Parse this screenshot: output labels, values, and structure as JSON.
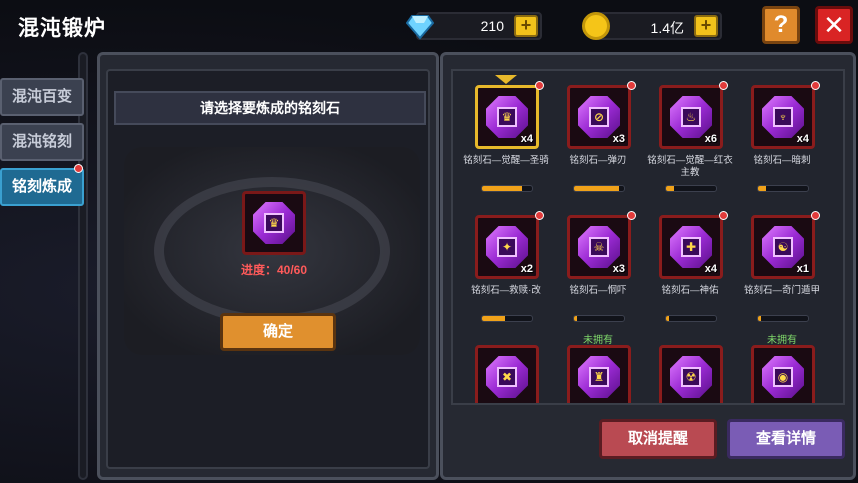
{
  "title": "混沌锻炉",
  "currency": {
    "gems": "210",
    "gold": "1.4亿",
    "plus": "+"
  },
  "buttons": {
    "help": "?",
    "close": "✕",
    "confirm": "确定",
    "cancel_reminder": "取消提醒",
    "view_details": "查看详情"
  },
  "tabs": [
    "混沌百变",
    "混沌铭刻",
    "铭刻炼成"
  ],
  "left": {
    "prompt": "请选择要炼成的铭刻石",
    "progress": "进度：40/60",
    "main_gem_symbol": "♛"
  },
  "cards": [
    {
      "name": "铭刻石—觉醒—圣骑",
      "qty": "x4",
      "progress": 0.8,
      "symbol": "♛",
      "selected": true
    },
    {
      "name": "铭刻石—弹刃",
      "qty": "x3",
      "progress": 0.9,
      "symbol": "⊘"
    },
    {
      "name": "铭刻石—觉醒—红衣主教",
      "qty": "x6",
      "progress": 0.15,
      "symbol": "♨"
    },
    {
      "name": "铭刻石—暗刺",
      "qty": "x4",
      "progress": 0.15,
      "symbol": "♆"
    },
    {
      "name": "铭刻石—救赎·改",
      "qty": "x2",
      "progress": 0.45,
      "symbol": "✦"
    },
    {
      "name": "铭刻石—恫吓",
      "qty": "x3",
      "progress": 0.05,
      "symbol": "☠"
    },
    {
      "name": "铭刻石—神佑",
      "qty": "x4",
      "progress": 0.05,
      "symbol": "✚"
    },
    {
      "name": "铭刻石—奇门遁甲",
      "qty": "x1",
      "progress": 0.05,
      "symbol": "☯"
    },
    {
      "name": "",
      "qty": "",
      "progress": null,
      "symbol": "✖",
      "unowned": ""
    },
    {
      "name": "",
      "qty": "",
      "progress": null,
      "symbol": "♜",
      "unowned": "未拥有"
    },
    {
      "name": "",
      "qty": "",
      "progress": null,
      "symbol": "☢",
      "unowned": ""
    },
    {
      "name": "",
      "qty": "",
      "progress": null,
      "symbol": "◉",
      "unowned": "未拥有"
    }
  ],
  "colors": {
    "accent_blue": "#1f6a92",
    "confirm_orange": "#e0902e",
    "cancel_red": "#b94a52",
    "details_purple": "#7a5cb5",
    "progress_red": "#ff5a5a"
  }
}
